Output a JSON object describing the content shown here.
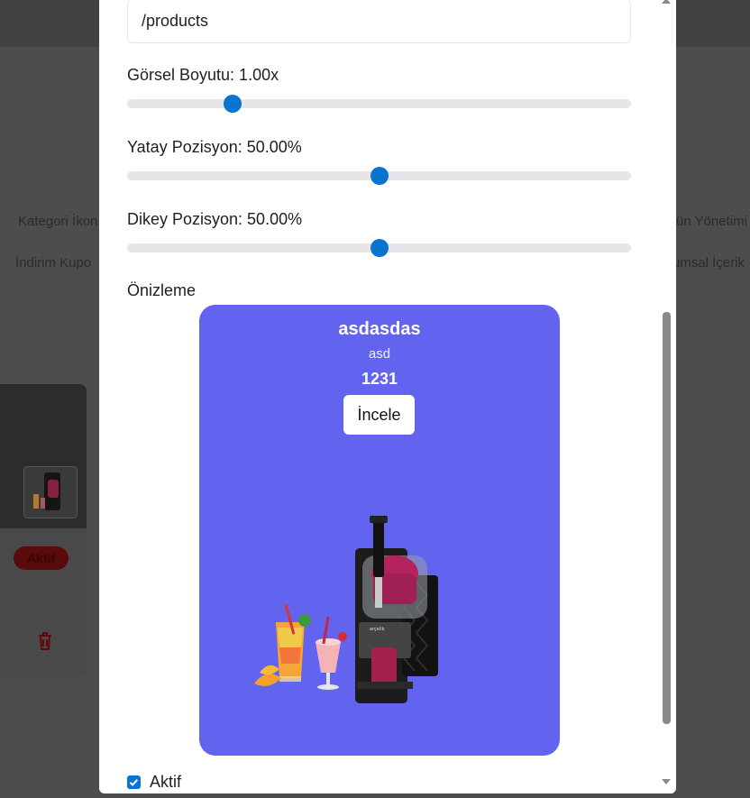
{
  "background": {
    "tabs_row1": [
      "Kategori İkon",
      "ün Yönetimi"
    ],
    "tabs_row2": [
      "İndirim Kupo",
      "umsal İçerik"
    ],
    "card_status_badge": "Aktif"
  },
  "modal": {
    "link_input_value": "/products",
    "image_size": {
      "label": "Görsel Boyutu: 1.00x",
      "value": 1.0,
      "fraction": 0.21
    },
    "horizontal_position": {
      "label": "Yatay Pozisyon: 50.00%",
      "value": 50.0
    },
    "vertical_position": {
      "label": "Dikey Pozisyon: 50.00%",
      "value": 50.0
    },
    "preview_label": "Önizleme",
    "preview": {
      "title": "asdasdas",
      "subtitle": "asd",
      "price": "1231",
      "button_label": "İncele",
      "background_color": "#6263ef"
    },
    "active_checkbox": {
      "label": "Aktif",
      "checked": true
    }
  },
  "colors": {
    "accent": "#0a74d1",
    "slider_track": "#e5e5ea"
  }
}
